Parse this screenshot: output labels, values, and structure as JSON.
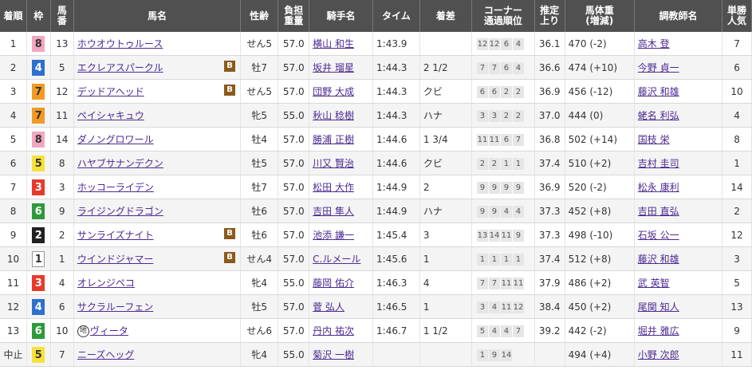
{
  "headers": {
    "rank": "着順",
    "waku": "枠",
    "umaban_1": "馬",
    "umaban_2": "番",
    "horse": "馬名",
    "sexage": "性齢",
    "weight_1": "負担",
    "weight_2": "重量",
    "jockey": "騎手名",
    "time": "タイム",
    "margin": "着差",
    "corner_1": "コーナー",
    "corner_2": "通過順位",
    "last3f_1": "推定",
    "last3f_2": "上り",
    "bodyweight_1": "馬体重",
    "bodyweight_2": "(増減)",
    "trainer": "調教師名",
    "pop_1": "単勝",
    "pop_2": "人気"
  },
  "waku_colors": {
    "1": {
      "bg": "#ffffff",
      "fg": "#333333",
      "border": "#999999"
    },
    "2": {
      "bg": "#222222",
      "fg": "#ffffff",
      "border": "#222222"
    },
    "3": {
      "bg": "#e83a2c",
      "fg": "#ffffff",
      "border": "#e83a2c"
    },
    "4": {
      "bg": "#2f6fd0",
      "fg": "#ffffff",
      "border": "#2f6fd0"
    },
    "5": {
      "bg": "#f6e23a",
      "fg": "#333333",
      "border": "#f6e23a"
    },
    "6": {
      "bg": "#2e9a3a",
      "fg": "#ffffff",
      "border": "#2e9a3a"
    },
    "7": {
      "bg": "#f39a24",
      "fg": "#333333",
      "border": "#f39a24"
    },
    "8": {
      "bg": "#f4a6c0",
      "fg": "#333333",
      "border": "#f4a6c0"
    }
  },
  "rows": [
    {
      "rank": "1",
      "waku": "8",
      "umaban": "13",
      "horse": "ホウオウトゥルース",
      "blinker": "",
      "local": "",
      "sexage": "せん5",
      "weight": "57.0",
      "jockey": "横山 和生",
      "time": "1:43.9",
      "margin": "",
      "corners": [
        "12",
        "12",
        "6",
        "4"
      ],
      "last3f": "36.1",
      "bodyweight": "470 (-2)",
      "trainer": "高木 登",
      "pop": "7"
    },
    {
      "rank": "2",
      "waku": "4",
      "umaban": "5",
      "horse": "エクレアスパークル",
      "blinker": "B",
      "local": "",
      "sexage": "牡7",
      "weight": "57.0",
      "jockey": "坂井 瑠星",
      "time": "1:44.3",
      "margin": "2 1/2",
      "corners": [
        "7",
        "7",
        "6",
        "4"
      ],
      "last3f": "36.6",
      "bodyweight": "474 (+10)",
      "trainer": "今野 貞一",
      "pop": "6"
    },
    {
      "rank": "3",
      "waku": "7",
      "umaban": "12",
      "horse": "デッドアヘッド",
      "blinker": "B",
      "local": "",
      "sexage": "せん5",
      "weight": "57.0",
      "jockey": "団野 大成",
      "time": "1:44.3",
      "margin": "クビ",
      "corners": [
        "6",
        "6",
        "2",
        "2"
      ],
      "last3f": "36.9",
      "bodyweight": "456 (-12)",
      "trainer": "藤沢 和雄",
      "pop": "10"
    },
    {
      "rank": "4",
      "waku": "7",
      "umaban": "11",
      "horse": "ペイシャキュウ",
      "blinker": "",
      "local": "",
      "sexage": "牝5",
      "weight": "55.0",
      "jockey": "秋山 稔樹",
      "time": "1:44.3",
      "margin": "ハナ",
      "corners": [
        "3",
        "3",
        "2",
        "2"
      ],
      "last3f": "37.0",
      "bodyweight": "444 (0)",
      "trainer": "蛯名 利弘",
      "pop": "4"
    },
    {
      "rank": "5",
      "waku": "8",
      "umaban": "14",
      "horse": "ダノングロワール",
      "blinker": "",
      "local": "",
      "sexage": "牡4",
      "weight": "57.0",
      "jockey": "勝浦 正樹",
      "time": "1:44.6",
      "margin": "1 3/4",
      "corners": [
        "11",
        "11",
        "6",
        "7"
      ],
      "last3f": "36.8",
      "bodyweight": "502 (+14)",
      "trainer": "国枝 栄",
      "pop": "8"
    },
    {
      "rank": "6",
      "waku": "5",
      "umaban": "8",
      "horse": "ハヤブサナンデクン",
      "blinker": "",
      "local": "",
      "sexage": "牡5",
      "weight": "57.0",
      "jockey": "川又 賢治",
      "time": "1:44.6",
      "margin": "クビ",
      "corners": [
        "2",
        "2",
        "1",
        "1"
      ],
      "last3f": "37.4",
      "bodyweight": "510 (+2)",
      "trainer": "吉村 圭司",
      "pop": "1"
    },
    {
      "rank": "7",
      "waku": "3",
      "umaban": "3",
      "horse": "ホッコーライデン",
      "blinker": "",
      "local": "",
      "sexage": "牡7",
      "weight": "57.0",
      "jockey": "松田 大作",
      "time": "1:44.9",
      "margin": "2",
      "corners": [
        "9",
        "9",
        "9",
        "9"
      ],
      "last3f": "36.9",
      "bodyweight": "520 (-2)",
      "trainer": "松永 康利",
      "pop": "14"
    },
    {
      "rank": "8",
      "waku": "6",
      "umaban": "9",
      "horse": "ライジングドラゴン",
      "blinker": "",
      "local": "",
      "sexage": "牡6",
      "weight": "57.0",
      "jockey": "吉田 隼人",
      "time": "1:44.9",
      "margin": "ハナ",
      "corners": [
        "9",
        "9",
        "4",
        "4"
      ],
      "last3f": "37.3",
      "bodyweight": "452 (+8)",
      "trainer": "吉田 直弘",
      "pop": "2"
    },
    {
      "rank": "9",
      "waku": "2",
      "umaban": "2",
      "horse": "サンライズナイト",
      "blinker": "B",
      "local": "",
      "sexage": "牡6",
      "weight": "57.0",
      "jockey": "池添 謙一",
      "time": "1:45.4",
      "margin": "3",
      "corners": [
        "13",
        "14",
        "11",
        "9"
      ],
      "last3f": "37.3",
      "bodyweight": "498 (-10)",
      "trainer": "石坂 公一",
      "pop": "12"
    },
    {
      "rank": "10",
      "waku": "1",
      "umaban": "1",
      "horse": "ウインドジャマー",
      "blinker": "B",
      "local": "",
      "sexage": "せん4",
      "weight": "57.0",
      "jockey": "C.ルメール",
      "time": "1:45.6",
      "margin": "1",
      "corners": [
        "1",
        "1",
        "1",
        "1"
      ],
      "last3f": "37.4",
      "bodyweight": "512 (+8)",
      "trainer": "藤沢 和雄",
      "pop": "3"
    },
    {
      "rank": "11",
      "waku": "3",
      "umaban": "4",
      "horse": "オレンジペコ",
      "blinker": "",
      "local": "",
      "sexage": "牝4",
      "weight": "55.0",
      "jockey": "藤岡 佑介",
      "time": "1:46.3",
      "margin": "4",
      "corners": [
        "7",
        "7",
        "11",
        "11"
      ],
      "last3f": "37.9",
      "bodyweight": "486 (+2)",
      "trainer": "武 英智",
      "pop": "5"
    },
    {
      "rank": "12",
      "waku": "4",
      "umaban": "6",
      "horse": "サクラルーフェン",
      "blinker": "",
      "local": "",
      "sexage": "牡5",
      "weight": "57.0",
      "jockey": "菅 弘人",
      "time": "1:46.5",
      "margin": "1",
      "corners": [
        "3",
        "4",
        "11",
        "12"
      ],
      "last3f": "38.4",
      "bodyweight": "450 (+2)",
      "trainer": "尾関 知人",
      "pop": "13"
    },
    {
      "rank": "13",
      "waku": "6",
      "umaban": "10",
      "horse": "ヴィータ",
      "blinker": "",
      "local": "地",
      "sexage": "せん6",
      "weight": "57.0",
      "jockey": "丹内 祐次",
      "time": "1:46.7",
      "margin": "1 1/2",
      "corners": [
        "5",
        "4",
        "4",
        "7"
      ],
      "last3f": "39.2",
      "bodyweight": "442 (-2)",
      "trainer": "堀井 雅広",
      "pop": "9"
    },
    {
      "rank": "中止",
      "waku": "5",
      "umaban": "7",
      "horse": "ニーズヘッグ",
      "blinker": "",
      "local": "",
      "sexage": "牝4",
      "weight": "55.0",
      "jockey": "菊沢 一樹",
      "time": "",
      "margin": "",
      "corners": [
        "1",
        "9",
        "14"
      ],
      "last3f": "",
      "bodyweight": "494 (+4)",
      "trainer": "小野 次郎",
      "pop": "11"
    }
  ]
}
